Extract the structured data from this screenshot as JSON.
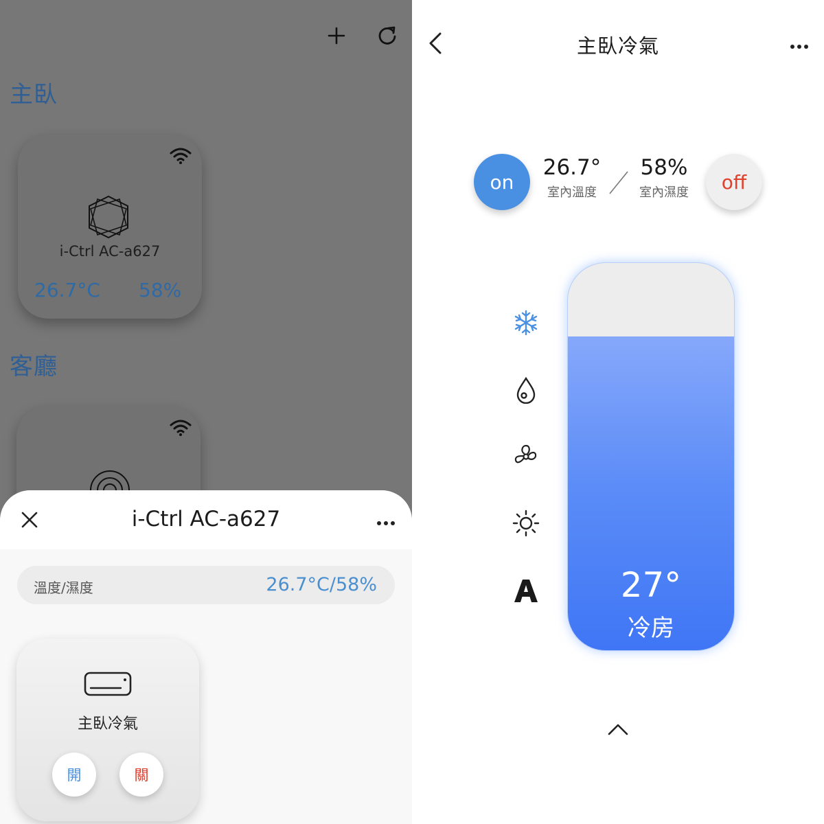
{
  "left": {
    "rooms": [
      {
        "title": "主臥",
        "device": {
          "name": "i-Ctrl AC-a627",
          "temperature": "26.7°C",
          "humidity": "58%"
        }
      },
      {
        "title": "客廳"
      }
    ],
    "sheet": {
      "title": "i-Ctrl AC-a627",
      "env_label": "溫度/濕度",
      "env_value": "26.7°C/58%",
      "appliance": {
        "name": "主臥冷氣",
        "on_label": "開",
        "off_label": "關"
      }
    }
  },
  "right": {
    "title": "主臥冷氣",
    "on_label": "on",
    "off_label": "off",
    "indoor_temp": "26.7°",
    "indoor_temp_label": "室內溫度",
    "indoor_humidity": "58%",
    "indoor_humidity_label": "室內濕度",
    "modes": [
      "snowflake-icon",
      "droplet-icon",
      "fan-icon",
      "sun-icon",
      "auto-icon"
    ],
    "set_temperature": "27°",
    "set_mode": "冷房",
    "slider_level_percent": 81
  },
  "colors": {
    "accent_blue": "#4a90e2",
    "off_red": "#e0402c",
    "room_title_blue": "#2f5f94",
    "slider_blue": "#3f76f5"
  }
}
